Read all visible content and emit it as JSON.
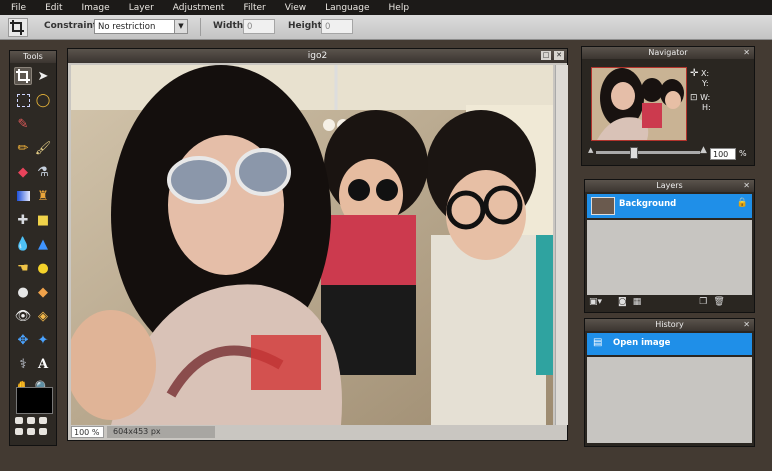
{
  "menu": [
    "File",
    "Edit",
    "Image",
    "Layer",
    "Adjustment",
    "Filter",
    "View",
    "Language",
    "Help"
  ],
  "options": {
    "constraint_label": "Constraint:",
    "constraint_value": "No restriction",
    "width_label": "Width:",
    "width_value": "0",
    "height_label": "Height:",
    "height_value": "0"
  },
  "tools_panel": {
    "title": "Tools"
  },
  "document": {
    "title": "igo2",
    "zoom": "100 %",
    "dimensions": "604x453 px"
  },
  "navigator": {
    "title": "Navigator",
    "x_label": "X:",
    "y_label": "Y:",
    "w_label": "W:",
    "h_label": "H:",
    "zoom_value": "100",
    "zoom_unit": "%"
  },
  "layers_panel": {
    "title": "Layers",
    "layer_name": "Background"
  },
  "history_panel": {
    "title": "History",
    "entry": "Open image"
  },
  "colors": {
    "accent": "#1f8fe8",
    "menubar": "#1c1a18",
    "panel": "#2a2621"
  }
}
